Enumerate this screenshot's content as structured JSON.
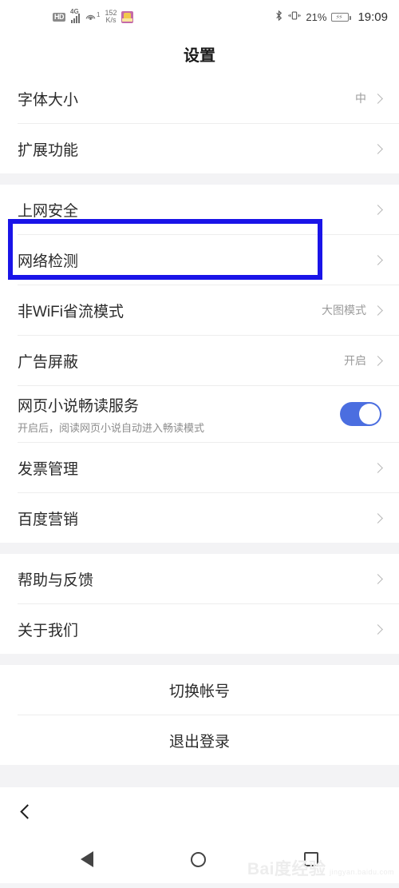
{
  "status_bar": {
    "hd_label": "HD",
    "network_type": "4G",
    "hotspot_count": "1",
    "speed_value": "152",
    "speed_unit": "K/s",
    "bluetooth_icon": "bluetooth-icon",
    "vibrate_icon": "vibrate-icon",
    "battery_percent": "21%",
    "time": "19:09"
  },
  "header": {
    "title": "设置"
  },
  "sections": [
    {
      "rows": [
        {
          "label": "字体大小",
          "value": "中",
          "accessory": "chevron"
        },
        {
          "label": "扩展功能",
          "value": "",
          "accessory": "chevron"
        }
      ]
    },
    {
      "rows": [
        {
          "label": "上网安全",
          "value": "",
          "accessory": "chevron"
        },
        {
          "label": "网络检测",
          "value": "",
          "accessory": "chevron",
          "highlighted": true
        },
        {
          "label": "非WiFi省流模式",
          "value": "大图模式",
          "accessory": "chevron"
        },
        {
          "label": "广告屏蔽",
          "value": "开启",
          "accessory": "chevron"
        },
        {
          "label": "网页小说畅读服务",
          "sublabel": "开启后，阅读网页小说自动进入畅读模式",
          "accessory": "toggle",
          "toggle_on": true
        },
        {
          "label": "发票管理",
          "value": "",
          "accessory": "chevron"
        },
        {
          "label": "百度营销",
          "value": "",
          "accessory": "chevron"
        }
      ]
    },
    {
      "rows": [
        {
          "label": "帮助与反馈",
          "value": "",
          "accessory": "chevron"
        },
        {
          "label": "关于我们",
          "value": "",
          "accessory": "chevron"
        }
      ]
    },
    {
      "rows": [
        {
          "label": "切换帐号",
          "centered": true
        },
        {
          "label": "退出登录",
          "centered": true
        }
      ]
    }
  ],
  "bottom": {
    "back_icon": "back-chevron-icon"
  },
  "nav_bar": {
    "back_icon": "nav-back-triangle-icon",
    "home_icon": "nav-home-circle-icon",
    "recents_icon": "nav-recents-square-icon"
  },
  "watermark": {
    "line1": "Bai度经验",
    "line2": "jingyan.baidu.com"
  },
  "colors": {
    "highlight_blue": "#1a14e8",
    "toggle_blue": "#4b6ee0",
    "page_bg": "#f3f3f5",
    "card_bg": "#ffffff"
  }
}
